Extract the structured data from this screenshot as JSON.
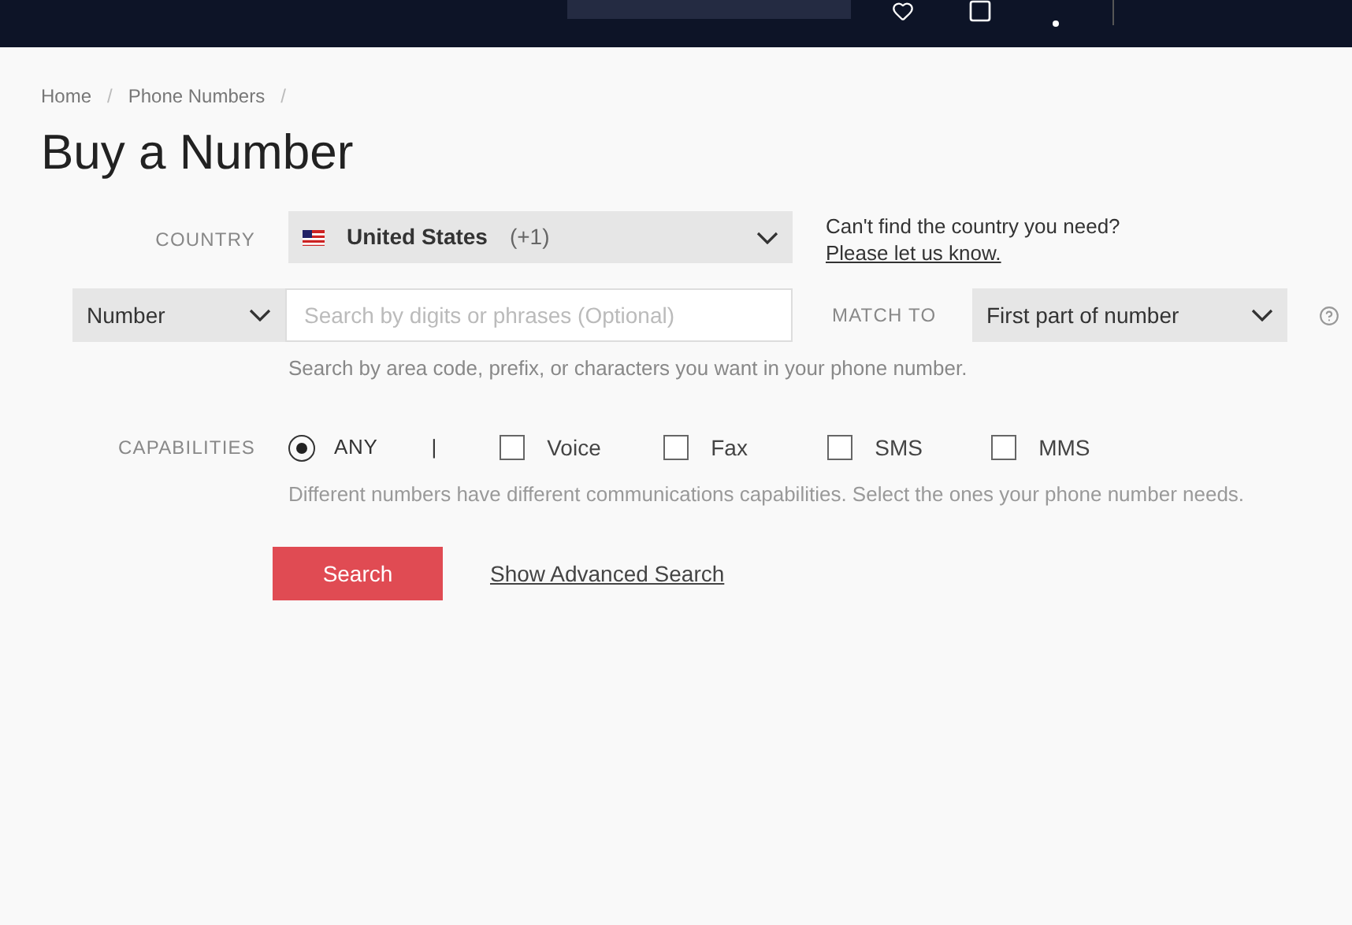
{
  "breadcrumbs": [
    "Home",
    "Phone Numbers"
  ],
  "breadcrumb_separator": "/",
  "title": "Buy a Number",
  "country": {
    "label": "COUNTRY",
    "value": "United States",
    "code": "(+1)",
    "help_text": "Can't find the country you need?",
    "help_link": "Please let us know."
  },
  "search": {
    "type": "Number",
    "placeholder": "Search by digits or phrases (Optional)",
    "match_label": "MATCH TO",
    "match_value": "First part of number",
    "hint": "Search by area code, prefix, or characters you want in your phone number."
  },
  "capabilities": {
    "label": "CAPABILITIES",
    "any": {
      "label": "ANY",
      "selected": true
    },
    "separator": "|",
    "options": [
      {
        "label": "Voice",
        "checked": false
      },
      {
        "label": "Fax",
        "checked": false
      },
      {
        "label": "SMS",
        "checked": false
      },
      {
        "label": "MMS",
        "checked": false
      }
    ],
    "hint": "Different numbers have different communications capabilities. Select the ones your phone number needs."
  },
  "buttons": {
    "search": "Search",
    "advanced": "Show Advanced Search"
  }
}
